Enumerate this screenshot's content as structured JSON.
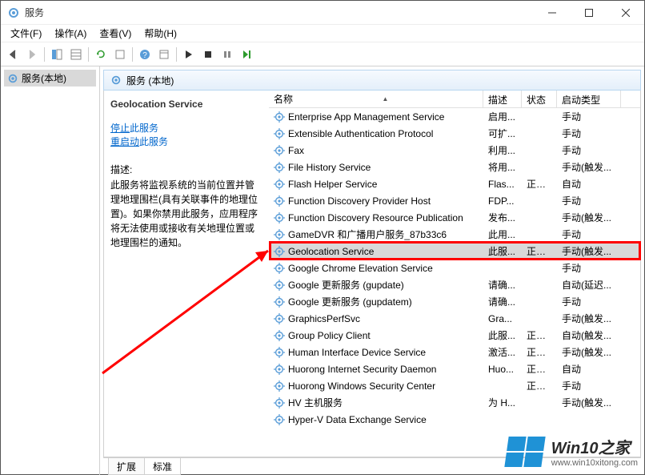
{
  "titlebar": {
    "title": "服务"
  },
  "menubar": [
    {
      "label": "文件(F)"
    },
    {
      "label": "操作(A)"
    },
    {
      "label": "查看(V)"
    },
    {
      "label": "帮助(H)"
    }
  ],
  "left_pane": {
    "tree_label": "服务(本地)"
  },
  "right_header": {
    "title": "服务 (本地)"
  },
  "detail": {
    "title": "Geolocation Service",
    "stop_link": "停止",
    "stop_suffix": "此服务",
    "restart_link": "重启动",
    "restart_suffix": "此服务",
    "desc_label": "描述:",
    "desc_text": "此服务将监视系统的当前位置并管理地理围栏(具有关联事件的地理位置)。如果你禁用此服务，应用程序将无法使用或接收有关地理位置或地理围栏的通知。"
  },
  "columns": {
    "name": "名称",
    "desc": "描述",
    "status": "状态",
    "type": "启动类型"
  },
  "services": [
    {
      "name": "Enterprise App Management Service",
      "desc": "启用...",
      "status": "",
      "type": "手动"
    },
    {
      "name": "Extensible Authentication Protocol",
      "desc": "可扩...",
      "status": "",
      "type": "手动"
    },
    {
      "name": "Fax",
      "desc": "利用...",
      "status": "",
      "type": "手动"
    },
    {
      "name": "File History Service",
      "desc": "将用...",
      "status": "",
      "type": "手动(触发..."
    },
    {
      "name": "Flash Helper Service",
      "desc": "Flas...",
      "status": "正在...",
      "type": "自动"
    },
    {
      "name": "Function Discovery Provider Host",
      "desc": "FDP...",
      "status": "",
      "type": "手动"
    },
    {
      "name": "Function Discovery Resource Publication",
      "desc": "发布...",
      "status": "",
      "type": "手动(触发..."
    },
    {
      "name": "GameDVR 和广播用户服务_87b33c6",
      "desc": "此用...",
      "status": "",
      "type": "手动"
    },
    {
      "name": "Geolocation Service",
      "desc": "此服...",
      "status": "正在...",
      "type": "手动(触发...",
      "selected": true
    },
    {
      "name": "Google Chrome Elevation Service",
      "desc": "",
      "status": "",
      "type": "手动"
    },
    {
      "name": "Google 更新服务 (gupdate)",
      "desc": "请确...",
      "status": "",
      "type": "自动(延迟..."
    },
    {
      "name": "Google 更新服务 (gupdatem)",
      "desc": "请确...",
      "status": "",
      "type": "手动"
    },
    {
      "name": "GraphicsPerfSvc",
      "desc": "Gra...",
      "status": "",
      "type": "手动(触发..."
    },
    {
      "name": "Group Policy Client",
      "desc": "此服...",
      "status": "正在...",
      "type": "自动(触发..."
    },
    {
      "name": "Human Interface Device Service",
      "desc": "激活...",
      "status": "正在...",
      "type": "手动(触发..."
    },
    {
      "name": "Huorong Internet Security Daemon",
      "desc": "Huo...",
      "status": "正在...",
      "type": "自动"
    },
    {
      "name": "Huorong Windows Security Center",
      "desc": "",
      "status": "正在...",
      "type": "手动"
    },
    {
      "name": "HV 主机服务",
      "desc": "为 H...",
      "status": "",
      "type": "手动(触发..."
    },
    {
      "name": "Hyper-V Data Exchange Service",
      "desc": "",
      "status": "",
      "type": ""
    }
  ],
  "tabs": {
    "extended": "扩展",
    "standard": "标准"
  },
  "watermark": {
    "title": "Win10之家",
    "url": "www.win10xitong.com"
  }
}
